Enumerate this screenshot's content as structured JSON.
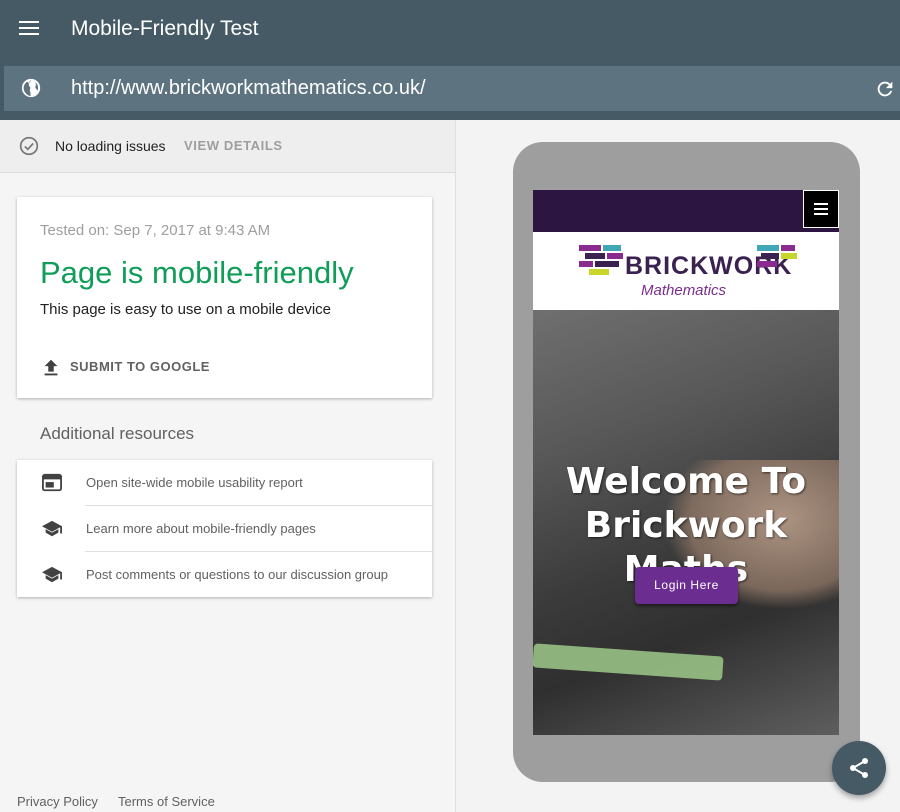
{
  "header": {
    "title": "Mobile-Friendly Test",
    "url": "http://www.brickworkmathematics.co.uk/",
    "background_color": "#455a64"
  },
  "status": {
    "text": "No loading issues",
    "view_details_label": "VIEW DETAILS"
  },
  "result": {
    "tested_on": "Tested on: Sep 7, 2017 at 9:43 AM",
    "title": "Page is mobile-friendly",
    "description": "This page is easy to use on a mobile device",
    "submit_label": "SUBMIT TO GOOGLE",
    "title_color": "#0f9d58"
  },
  "resources": {
    "heading": "Additional resources",
    "items": [
      {
        "label": "Open site-wide mobile usability report",
        "icon": "web-report-icon"
      },
      {
        "label": "Learn more about mobile-friendly pages",
        "icon": "school-icon"
      },
      {
        "label": "Post comments or questions to our discussion group",
        "icon": "school-icon"
      }
    ]
  },
  "footer": {
    "privacy": "Privacy Policy",
    "terms": "Terms of Service"
  },
  "preview": {
    "logo_brand": "BRICKWORK",
    "logo_sub": "Mathematics",
    "hero_line1": "Welcome To",
    "hero_line2": "Brickwork Maths",
    "login_label": "Login Here",
    "brand_color": "#6c2d91"
  }
}
